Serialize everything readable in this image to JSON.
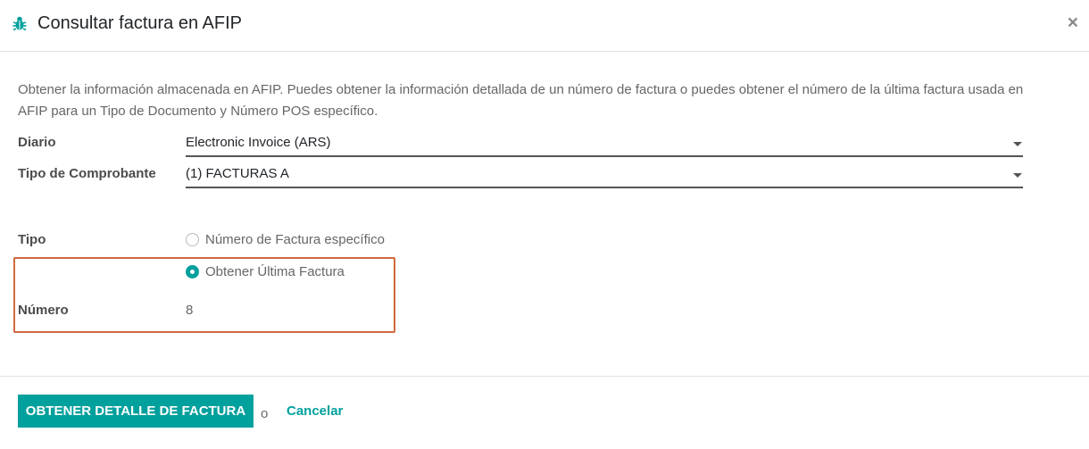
{
  "dialog": {
    "title": "Consultar factura en AFIP",
    "close_label": "×",
    "icon": "bug-icon"
  },
  "intro": "Obtener la información almacenada en AFIP. Puedes obtener la información detallada de un número de factura o puedes obtener el número de la última factura usada en AFIP para un Tipo de Documento y Número POS específico.",
  "form": {
    "diario": {
      "label": "Diario",
      "value": "Electronic Invoice (ARS)"
    },
    "tipo_comprobante": {
      "label": "Tipo de Comprobante",
      "value": "(1) FACTURAS A"
    },
    "tipo": {
      "label": "Tipo",
      "options": [
        {
          "label": "Número de Factura específico",
          "checked": false
        },
        {
          "label": "Obtener Última Factura",
          "checked": true
        }
      ]
    },
    "numero": {
      "label": "Número",
      "value": "8"
    }
  },
  "footer": {
    "primary_label": "OBTENER DETALLE DE FACTURA",
    "or_text": "o",
    "cancel_label": "Cancelar"
  },
  "colors": {
    "accent": "#00a09d",
    "highlight_border": "#d0693f"
  }
}
